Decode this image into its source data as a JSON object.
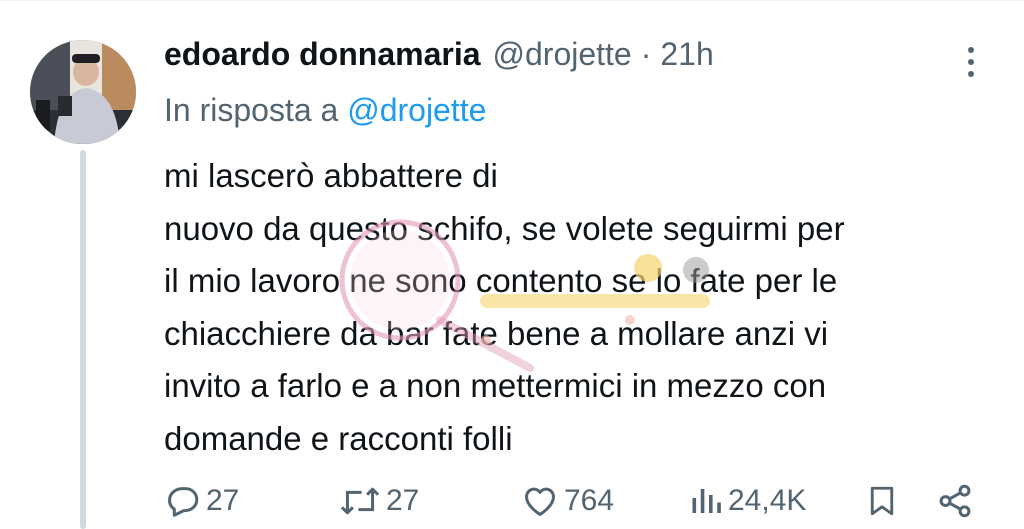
{
  "tweet": {
    "author_name": "edoardo donnamaria",
    "handle": "@drojette",
    "separator": "·",
    "time": "21h",
    "reply_prefix": "In risposta a",
    "reply_mention": "@drojette",
    "lines": [
      "mi lascerò abbattere di",
      "nuovo da questo schifo, se volete seguirmi per",
      "il mio lavoro ne sono contento se lo fate per le",
      "chiacchiere da bar fate bene a mollare anzi vi",
      "invito a farlo e a non mettermici in mezzo con",
      "domande e racconti folli"
    ]
  },
  "actions": {
    "replies": "27",
    "retweets": "27",
    "likes": "764",
    "views": "24,4K"
  },
  "icons": {
    "reply": "reply-icon",
    "retweet": "retweet-icon",
    "like": "heart-icon",
    "views": "views-icon",
    "bookmark": "bookmark-icon",
    "share": "share-icon",
    "more": "more-icon"
  },
  "colors": {
    "text": "#0f1419",
    "secondary": "#536471",
    "mention": "#1d9bf0",
    "thread_line": "#cfd9de"
  }
}
